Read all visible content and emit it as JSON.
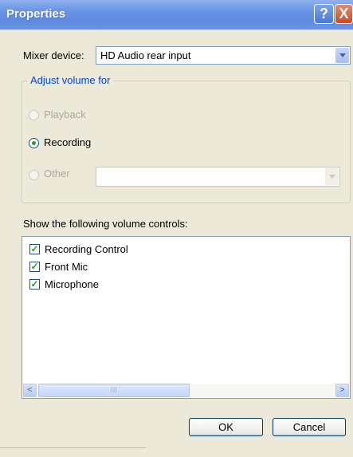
{
  "window": {
    "title": "Properties"
  },
  "title_buttons": {
    "help": "?",
    "close": "X"
  },
  "mixer": {
    "label": "Mixer device:",
    "selected": "HD Audio rear input"
  },
  "adjust": {
    "caption": "Adjust volume for",
    "options": [
      {
        "label": "Playback",
        "enabled": false,
        "selected": false
      },
      {
        "label": "Recording",
        "enabled": true,
        "selected": true
      },
      {
        "label": "Other",
        "enabled": false,
        "selected": false
      }
    ],
    "other_combo_value": ""
  },
  "controls": {
    "label": "Show the following volume controls:",
    "items": [
      {
        "label": "Recording Control",
        "checked": true
      },
      {
        "label": "Front Mic",
        "checked": true
      },
      {
        "label": "Microphone",
        "checked": true
      }
    ],
    "scroll_left": "<",
    "scroll_right": ">",
    "thumb_grip": "III"
  },
  "buttons": {
    "ok": "OK",
    "cancel": "Cancel"
  },
  "colors": {
    "title_bar": "#6b95e4",
    "dialog_bg": "#ece9d8",
    "group_caption": "#0046d5",
    "check": "#21a121"
  }
}
